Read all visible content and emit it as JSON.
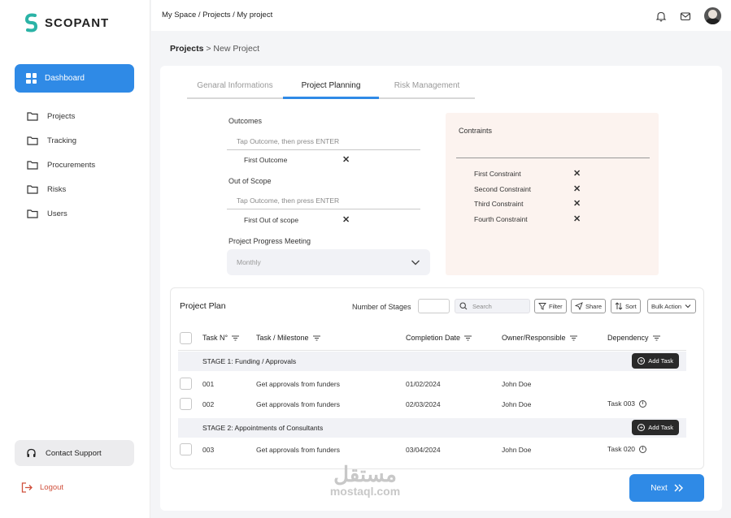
{
  "brand": {
    "name": "SCOPANT",
    "accent": "#2f8ae6"
  },
  "sidebar": {
    "active": {
      "label": "Dashboard",
      "icon": "grid-icon"
    },
    "items": [
      {
        "label": "Projects",
        "icon": "folder-icon"
      },
      {
        "label": "Tracking",
        "icon": "folder-icon"
      },
      {
        "label": "Procurements",
        "icon": "folder-icon"
      },
      {
        "label": "Risks",
        "icon": "folder-icon"
      },
      {
        "label": "Users",
        "icon": "folder-icon"
      }
    ],
    "support_label": "Contact Support",
    "logout_label": "Logout"
  },
  "topbar": {
    "breadcrumb": "My Space / Projects / My project"
  },
  "page": {
    "crumb_parent": "Projects",
    "crumb_sep": " > ",
    "crumb_current": "New Project"
  },
  "tabs": [
    "Genaral Informations",
    "Project Planning",
    "Risk Management"
  ],
  "form": {
    "outcomes_label": "Outcomes",
    "outcomes_placeholder": "Tap Outcome, then press ENTER",
    "outcomes": [
      "First Outcome"
    ],
    "scope_label": "Out of Scope",
    "scope_placeholder": "Tap Outcome, then press ENTER",
    "scope_items": [
      "First Out of scope"
    ],
    "meeting_label": "Project Progress Meeting",
    "meeting_value": "Monthly"
  },
  "constraints": {
    "title": "Contraints",
    "items": [
      "First Constraint",
      "Second Constraint",
      "Third Constraint",
      "Fourth Constraint"
    ]
  },
  "plan": {
    "title": "Project Plan",
    "stages_label": "Number of Stages",
    "search_placeholder": "Search",
    "buttons": {
      "filter": "Filter",
      "share": "Share",
      "sort": "Sort",
      "bulk": "Bulk Action"
    },
    "columns": [
      "Task N°",
      "Task / Milestone",
      "Completion Date",
      "Owner/Responsible",
      "Dependency"
    ],
    "add_task_label": "Add Task",
    "stages": [
      {
        "title": "STAGE 1: Funding / Approvals",
        "rows": [
          {
            "no": "001",
            "task": "Get approvals from funders",
            "date": "01/02/2024",
            "owner": "John Doe",
            "dependency": ""
          },
          {
            "no": "002",
            "task": "Get approvals from funders",
            "date": "02/03/2024",
            "owner": "John Doe",
            "dependency": "Task 003"
          }
        ]
      },
      {
        "title": "STAGE 2: Appointments of Consultants",
        "rows": [
          {
            "no": "003",
            "task": "Get approvals from funders",
            "date": "03/04/2024",
            "owner": "John Doe",
            "dependency": "Task 020"
          }
        ]
      }
    ]
  },
  "next_label": "Next",
  "watermark": {
    "arabic": "مستقل",
    "latin": "mostaql.com"
  }
}
